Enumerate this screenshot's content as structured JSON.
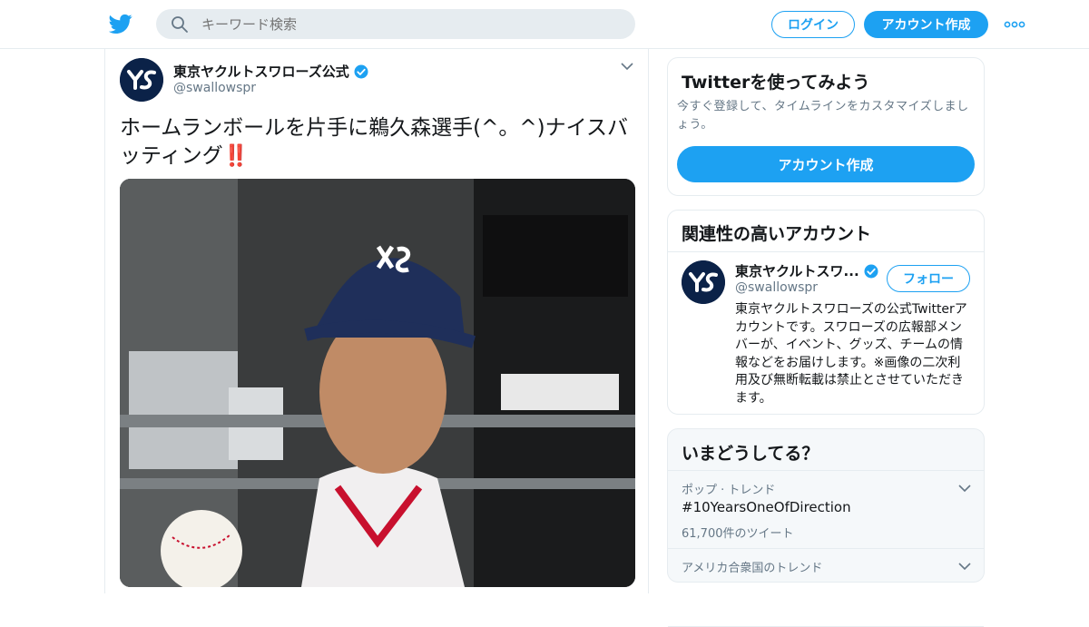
{
  "header": {
    "search_placeholder": "キーワード検索",
    "login_label": "ログイン",
    "signup_label": "アカウント作成",
    "icons": {
      "logo": "twitter-bird-icon",
      "search": "search-icon",
      "more": "more-dots-icon"
    }
  },
  "tweet": {
    "display_name": "東京ヤクルトスワローズ公式",
    "handle": "@swallowspr",
    "text": "ホームランボールを片手に鵜久森選手(^。^)ナイスバッティング",
    "emoji": "‼️"
  },
  "signup_card": {
    "title": "Twitterを使ってみよう",
    "description": "今すぐ登録して、タイムラインをカスタマイズしましょう。",
    "button_label": "アカウント作成"
  },
  "related": {
    "title": "関連性の高いアカウント",
    "name": "東京ヤクルトスワ...",
    "handle": "@swallowspr",
    "follow_label": "フォロー",
    "bio": "東京ヤクルトスワローズの公式Twitterアカウントです。スワローズの広報部メンバーが、イベント、グッズ、チームの情報などをお届けします。※画像の二次利用及び無断転載は禁止とさせていただきます。"
  },
  "trends": {
    "title": "いまどうしてる？",
    "items": [
      {
        "context": "ポップ · トレンド",
        "name": "#10YearsOneOfDirection",
        "count": "61,700件のツイート"
      },
      {
        "context": "アメリカ合衆国のトレンド",
        "name": "",
        "count": ""
      }
    ]
  },
  "colors": {
    "accent": "#1da1f2",
    "border": "#e6ecf0",
    "muted": "#657786",
    "brand_navy": "#0b2248"
  }
}
